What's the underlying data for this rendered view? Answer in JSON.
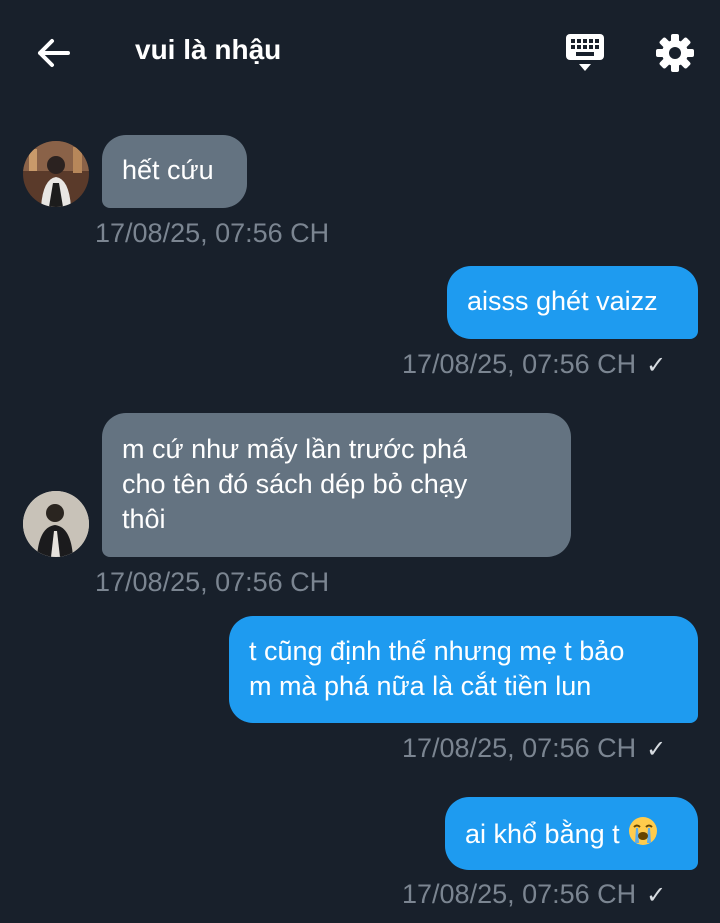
{
  "header": {
    "title": "vui là nhậu",
    "back_icon": "arrow-left-icon",
    "keyboard_icon": "keyboard-icon",
    "settings_icon": "gear-icon"
  },
  "colors": {
    "background": "#18202b",
    "incoming_bubble": "#647381",
    "outgoing_bubble": "#1e9bf0",
    "timestamp": "#7b8591"
  },
  "messages": [
    {
      "direction": "incoming",
      "text": "hết cứu",
      "time": "17/08/25, 07:56 CH"
    },
    {
      "direction": "outgoing",
      "text": "aisss ghét vaizz",
      "time": "17/08/25, 07:56 CH",
      "status": "✓"
    },
    {
      "direction": "incoming",
      "line1": "m cứ như mấy lần trước phá",
      "line2": "cho tên đó sách dép bỏ chạy",
      "line3": "thôi",
      "time": "17/08/25, 07:56 CH"
    },
    {
      "direction": "outgoing",
      "line1": "t cũng định thế nhưng mẹ t bảo",
      "line2": "m mà phá nữa là cắt tiền lun",
      "time": "17/08/25, 07:56 CH",
      "status": "✓"
    },
    {
      "direction": "outgoing",
      "text": "ai khổ bằng t",
      "emoji": "loudly-crying-face",
      "time": "17/08/25, 07:56 CH",
      "status": "✓"
    }
  ]
}
